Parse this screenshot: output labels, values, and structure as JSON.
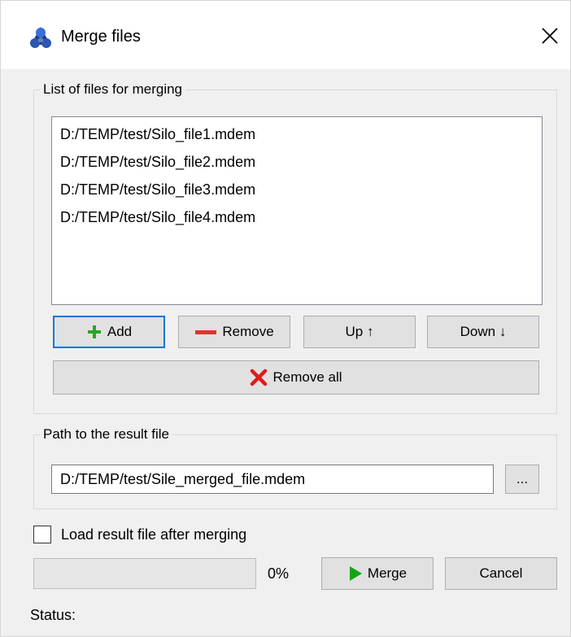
{
  "window": {
    "title": "Merge files",
    "icon": "app-logo-icon",
    "close_icon": "close-icon"
  },
  "files_group": {
    "label": "List of files for merging",
    "files": [
      "D:/TEMP/test/Silo_file1.mdem",
      "D:/TEMP/test/Silo_file2.mdem",
      "D:/TEMP/test/Silo_file3.mdem",
      "D:/TEMP/test/Silo_file4.mdem"
    ],
    "buttons": {
      "add": "Add",
      "remove": "Remove",
      "up": "Up ↑",
      "down": "Down ↓",
      "remove_all": "Remove all"
    }
  },
  "result_group": {
    "label": "Path to the result file",
    "path_value": "D:/TEMP/test/Sile_merged_file.mdem",
    "browse_label": "..."
  },
  "options": {
    "load_after_label": "Load result file after merging",
    "load_after_checked": false
  },
  "progress": {
    "percent_text": "0%",
    "fraction": 0
  },
  "actions": {
    "merge": "Merge",
    "cancel": "Cancel"
  },
  "status": {
    "label": "Status:"
  },
  "colors": {
    "add_green": "#2aa52a",
    "remove_red": "#e0342c",
    "remove_all_red": "#e01b1b",
    "merge_play_green": "#17a317",
    "focus_blue": "#0078d7",
    "logo_blue": "#1f3c88"
  }
}
